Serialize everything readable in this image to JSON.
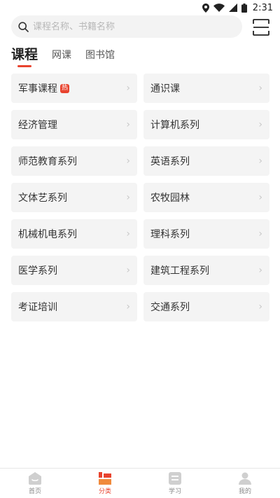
{
  "status": {
    "time": "2:31"
  },
  "search": {
    "placeholder": "课程名称、书籍名称"
  },
  "tabs": [
    {
      "label": "课程",
      "active": true
    },
    {
      "label": "网课",
      "active": false
    },
    {
      "label": "图书馆",
      "active": false
    }
  ],
  "categories": [
    {
      "label": "军事课程",
      "badge": "热"
    },
    {
      "label": "通识课"
    },
    {
      "label": "经济管理"
    },
    {
      "label": "计算机系列"
    },
    {
      "label": "师范教育系列"
    },
    {
      "label": "英语系列"
    },
    {
      "label": "文体艺系列"
    },
    {
      "label": "农牧园林"
    },
    {
      "label": "机械机电系列"
    },
    {
      "label": "理科系列"
    },
    {
      "label": "医学系列"
    },
    {
      "label": "建筑工程系列"
    },
    {
      "label": "考证培训"
    },
    {
      "label": "交通系列"
    }
  ],
  "chevron": "›",
  "bottom_nav": [
    {
      "label": "首页",
      "icon": "home-icon"
    },
    {
      "label": "分类",
      "icon": "category-icon",
      "active": true
    },
    {
      "label": "学习",
      "icon": "study-icon"
    },
    {
      "label": "我的",
      "icon": "profile-icon"
    }
  ],
  "colors": {
    "accent": "#e8432e",
    "cell_bg": "#f4f4f4",
    "nav_inactive": "#cfcfcf"
  }
}
